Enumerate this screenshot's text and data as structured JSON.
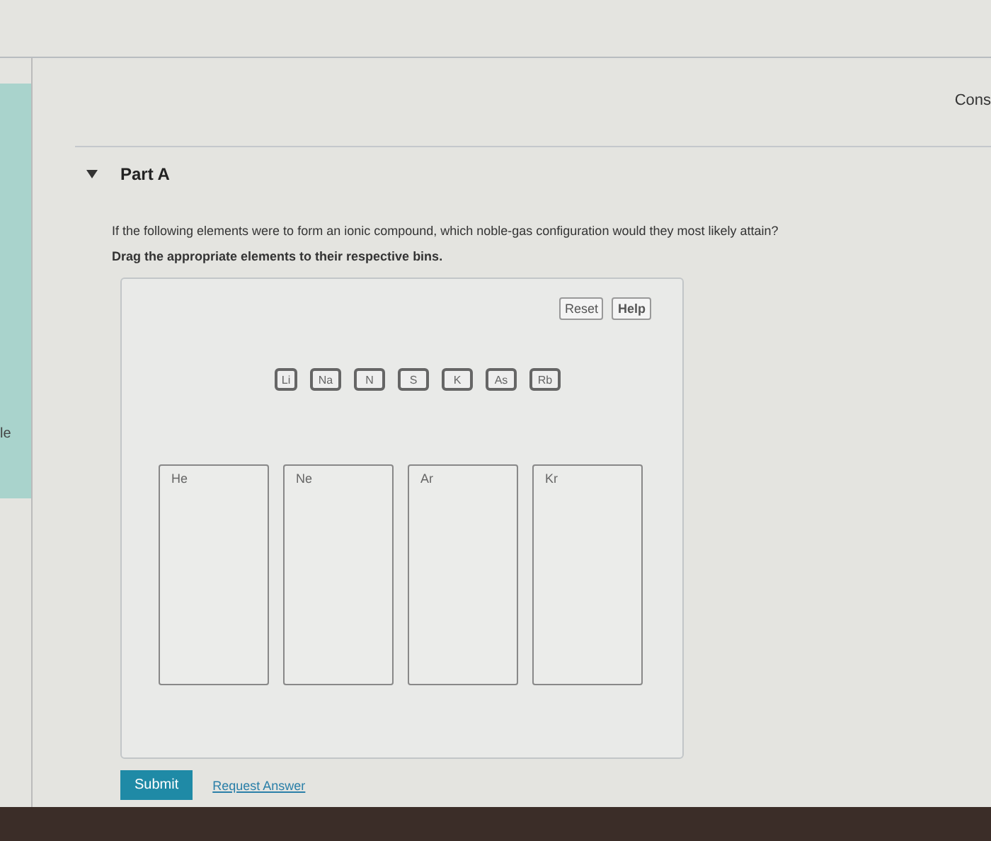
{
  "side_tab": "le",
  "constants_link": "Cons",
  "part": {
    "title": "Part A",
    "expanded": true
  },
  "question": "If the following elements were to form an ionic compound, which noble-gas configuration would they most likely attain?",
  "instruction": "Drag the appropriate elements to their respective bins.",
  "tools": [
    "Reset",
    "Help"
  ],
  "elements": [
    "Li",
    "Na",
    "N",
    "S",
    "K",
    "As",
    "Rb"
  ],
  "bins": [
    "He",
    "Ne",
    "Ar",
    "Kr"
  ],
  "submit": "Submit",
  "request_answer": "Request Answer"
}
